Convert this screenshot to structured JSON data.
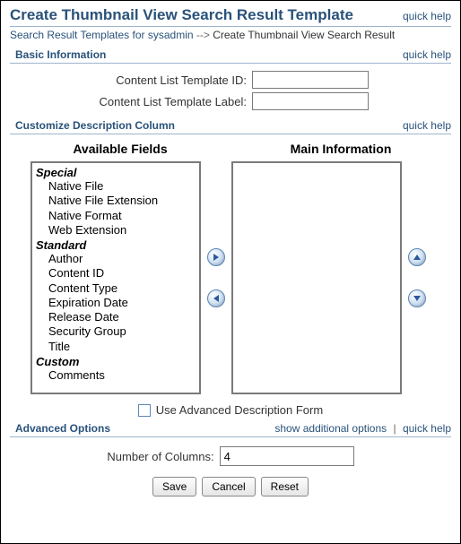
{
  "header": {
    "title": "Create Thumbnail View Search Result Template",
    "quick_help": "quick help"
  },
  "breadcrumb": {
    "link": "Search Result Templates for sysadmin",
    "sep": " --> ",
    "current": "Create Thumbnail View Search Result"
  },
  "basic": {
    "title": "Basic Information",
    "quick_help": "quick help",
    "id_label": "Content List Template ID:",
    "id_value": "",
    "label_label": "Content List Template Label:",
    "label_value": ""
  },
  "customize": {
    "title": "Customize Description Column",
    "quick_help": "quick help",
    "available_header": "Available Fields",
    "main_header": "Main Information",
    "available": {
      "groups": [
        {
          "name": "Special",
          "items": [
            "Native File",
            "Native File Extension",
            "Native Format",
            "Web Extension"
          ]
        },
        {
          "name": "Standard",
          "items": [
            "Author",
            "Content ID",
            "Content Type",
            "Expiration Date",
            "Release Date",
            "Security Group",
            "Title"
          ]
        },
        {
          "name": "Custom",
          "items": [
            "Comments"
          ]
        }
      ]
    },
    "use_advanced_label": "Use Advanced Description Form"
  },
  "advanced": {
    "title": "Advanced Options",
    "show_link": "show additional options",
    "quick_help": "quick help",
    "num_label": "Number of Columns:",
    "num_value": "4"
  },
  "buttons": {
    "save": "Save",
    "cancel": "Cancel",
    "reset": "Reset"
  }
}
